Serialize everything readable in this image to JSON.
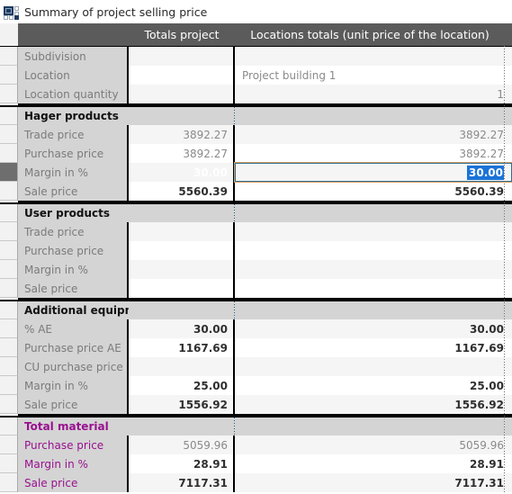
{
  "window": {
    "title": "Summary of project selling price",
    "icon": "grid-squares-icon"
  },
  "colors": {
    "header_bg": "#5b5b5b",
    "section_bg": "#d4d4d4",
    "selected_cell": "#1d6186",
    "edit_selection": "#1a73d8",
    "total_material_text": "#99108f",
    "label_text": "#7b7b7b"
  },
  "table": {
    "columns": [
      {
        "key": "label",
        "label": ""
      },
      {
        "key": "totals_project",
        "label": "Totals project"
      },
      {
        "key": "locations_totals",
        "label": "Locations totals (unit price of the location)"
      }
    ],
    "rows": [
      {
        "type": "data",
        "label": "Subdivision",
        "totals": "",
        "locations": "",
        "loc_align": "right",
        "bold": false
      },
      {
        "type": "data",
        "label": "Location",
        "totals": "",
        "locations": "Project building 1",
        "loc_align": "left",
        "bold": false
      },
      {
        "type": "data",
        "label": "Location quantity",
        "totals": "",
        "locations": "1",
        "loc_align": "right",
        "bold": false
      },
      {
        "type": "section",
        "label": "Hager products",
        "totals": "",
        "locations": ""
      },
      {
        "type": "data",
        "label": "Trade price",
        "totals": "3892.27",
        "locations": "3892.27",
        "bold": false
      },
      {
        "type": "data",
        "label": "Purchase price",
        "totals": "3892.27",
        "locations": "3892.27",
        "bold": false
      },
      {
        "type": "data",
        "label": "Margin in %",
        "totals": "30.00",
        "locations": "30.00",
        "bold": true,
        "selected": true,
        "editing": true
      },
      {
        "type": "data",
        "label": "Sale price",
        "totals": "5560.39",
        "locations": "5560.39",
        "bold": true
      },
      {
        "type": "section",
        "label": "User products",
        "totals": "",
        "locations": ""
      },
      {
        "type": "data",
        "label": "Trade price",
        "totals": "",
        "locations": "",
        "bold": false
      },
      {
        "type": "data",
        "label": "Purchase price",
        "totals": "",
        "locations": "",
        "bold": false
      },
      {
        "type": "data",
        "label": "Margin in %",
        "totals": "",
        "locations": "",
        "bold": false
      },
      {
        "type": "data",
        "label": "Sale price",
        "totals": "",
        "locations": "",
        "bold": false
      },
      {
        "type": "section",
        "label": "Additional equipment",
        "totals": "",
        "locations": ""
      },
      {
        "type": "data",
        "label": "% AE",
        "totals": "30.00",
        "locations": "30.00",
        "bold": true
      },
      {
        "type": "data",
        "label": "Purchase price AE",
        "totals": "1167.69",
        "locations": "1167.69",
        "bold": true
      },
      {
        "type": "data",
        "label": "CU purchase price",
        "totals": "",
        "locations": "",
        "bold": false
      },
      {
        "type": "data",
        "label": "Margin in %",
        "totals": "25.00",
        "locations": "25.00",
        "bold": true
      },
      {
        "type": "data",
        "label": "Sale price",
        "totals": "1556.92",
        "locations": "1556.92",
        "bold": true
      },
      {
        "type": "section",
        "label": "Total material",
        "totals": "",
        "locations": "",
        "purple": true
      },
      {
        "type": "data",
        "label": "Purchase price",
        "totals": "5059.96",
        "locations": "5059.96",
        "bold": false,
        "purple": true
      },
      {
        "type": "data",
        "label": "Margin in %",
        "totals": "28.91",
        "locations": "28.91",
        "bold": true,
        "purple": true
      },
      {
        "type": "data",
        "label": "Sale price",
        "totals": "7117.31",
        "locations": "7117.31",
        "bold": true,
        "purple": true
      }
    ]
  }
}
